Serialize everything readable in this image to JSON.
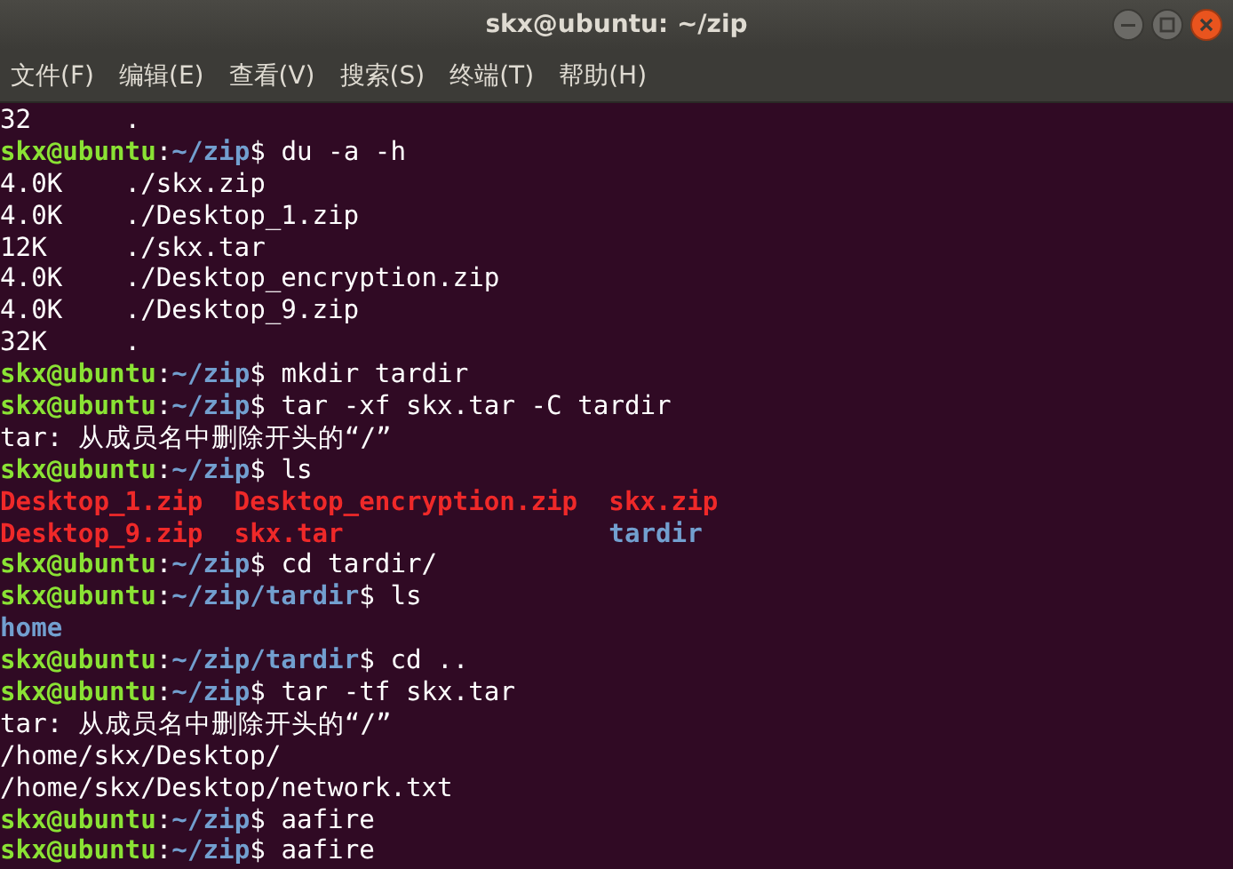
{
  "window": {
    "title": "skx@ubuntu: ~/zip"
  },
  "menu": [
    "文件(F)",
    "编辑(E)",
    "查看(V)",
    "搜索(S)",
    "终端(T)",
    "帮助(H)"
  ],
  "lines": [
    {
      "kind": "du",
      "size": "32",
      "path": "."
    },
    {
      "kind": "prompt",
      "user": "skx@ubuntu",
      "colon": ":",
      "path": "~/zip",
      "dollar": "$",
      "command": "du -a -h"
    },
    {
      "kind": "du",
      "size": "4.0K",
      "path": "./skx.zip"
    },
    {
      "kind": "du",
      "size": "4.0K",
      "path": "./Desktop_1.zip"
    },
    {
      "kind": "du",
      "size": "12K",
      "path": "./skx.tar"
    },
    {
      "kind": "du",
      "size": "4.0K",
      "path": "./Desktop_encryption.zip"
    },
    {
      "kind": "du",
      "size": "4.0K",
      "path": "./Desktop_9.zip"
    },
    {
      "kind": "du",
      "size": "32K",
      "path": "."
    },
    {
      "kind": "prompt",
      "user": "skx@ubuntu",
      "colon": ":",
      "path": "~/zip",
      "dollar": "$",
      "command": "mkdir tardir"
    },
    {
      "kind": "prompt",
      "user": "skx@ubuntu",
      "colon": ":",
      "path": "~/zip",
      "dollar": "$",
      "command": "tar -xf skx.tar -C tardir"
    },
    {
      "kind": "output",
      "text": "tar: 从成员名中删除开头的“/”"
    },
    {
      "kind": "prompt",
      "user": "skx@ubuntu",
      "colon": ":",
      "path": "~/zip",
      "dollar": "$",
      "command": "ls"
    },
    {
      "kind": "listing",
      "columns": [
        [
          {
            "name": "Desktop_1.zip",
            "kind": "archive"
          },
          {
            "name": "Desktop_9.zip",
            "kind": "archive"
          }
        ],
        [
          {
            "name": "Desktop_encryption.zip",
            "kind": "archive"
          },
          {
            "name": "skx.tar",
            "kind": "archive"
          }
        ],
        [
          {
            "name": "skx.zip",
            "kind": "archive"
          },
          {
            "name": "tardir",
            "kind": "directory"
          }
        ]
      ]
    },
    {
      "kind": "prompt",
      "user": "skx@ubuntu",
      "colon": ":",
      "path": "~/zip",
      "dollar": "$",
      "command": "cd tardir/"
    },
    {
      "kind": "prompt",
      "user": "skx@ubuntu",
      "colon": ":",
      "path": "~/zip/tardir",
      "dollar": "$",
      "command": "ls"
    },
    {
      "kind": "listing",
      "columns": [
        [
          {
            "name": "home",
            "kind": "directory"
          }
        ]
      ]
    },
    {
      "kind": "prompt",
      "user": "skx@ubuntu",
      "colon": ":",
      "path": "~/zip/tardir",
      "dollar": "$",
      "command": "cd .."
    },
    {
      "kind": "prompt",
      "user": "skx@ubuntu",
      "colon": ":",
      "path": "~/zip",
      "dollar": "$",
      "command": "tar -tf skx.tar"
    },
    {
      "kind": "output",
      "text": "tar: 从成员名中删除开头的“/”"
    },
    {
      "kind": "output",
      "text": "/home/skx/Desktop/"
    },
    {
      "kind": "output",
      "text": "/home/skx/Desktop/network.txt"
    },
    {
      "kind": "prompt",
      "user": "skx@ubuntu",
      "colon": ":",
      "path": "~/zip",
      "dollar": "$",
      "command": "aafire"
    },
    {
      "kind": "prompt",
      "user": "skx@ubuntu",
      "colon": ":",
      "path": "~/zip",
      "dollar": "$",
      "command": "aafire"
    }
  ]
}
